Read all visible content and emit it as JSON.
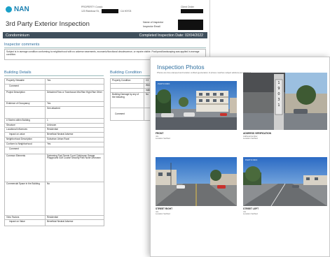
{
  "report": {
    "logo_text": "NAN",
    "property_label": "PROPERTY  Condo",
    "address": "123 Rainbow St,",
    "state_zip": "CA 90703",
    "corner_label": "Client Order",
    "title": "3rd Party Exterior Inspection",
    "name_of_inspector_label": "Name of Inspector",
    "inspector_email_label": "Inspector Email",
    "property_type": "Condominium",
    "completed_label": "Completed Inspection Date: 02/04/2022",
    "inspector_comments_title": "Inspector comments",
    "inspector_comment": "Subject is in average condition conforming to neighborhood with no adverse easements, economic/functional obsolescence, or repairs visible. Pool/pond/landscaping was applied in average condition.",
    "building_details_title": "Building Details",
    "building_condition_title": "Building Condition"
  },
  "building_details": [
    {
      "label": "Property Viewable",
      "value": "Yes"
    },
    {
      "label": "Comment",
      "value": ""
    },
    {
      "label": "Project Description",
      "value": "Detached  Row or Townhouse  Mid-Rise  High-Rise  Other"
    },
    {
      "label": "Evidence of Occupancy",
      "value": "Yes"
    },
    {
      "label": "",
      "value": "See attached"
    },
    {
      "label": "# Stories within Building",
      "value": "1"
    },
    {
      "label": "Structure",
      "value": "Unknown"
    },
    {
      "label": "Locational Influences",
      "value": "Residential"
    },
    {
      "label": "Impact on value",
      "value": "Beneficial  Neutral  Adverse"
    },
    {
      "label": "Neighborhood Description",
      "value": "Suburban  Urban  Rural"
    },
    {
      "label": "Conform to Neighborhood",
      "value": "Yes"
    },
    {
      "label": "Comment",
      "value": ""
    },
    {
      "label": "Common Elements",
      "value": "Swimming Pool  Tennis Court  Clubhouse  Garage  Playground  Golf Course  Security  Park  None  Unknown"
    },
    {
      "label": "Commercial Space in the Building",
      "value": "No"
    },
    {
      "label": "View Factors",
      "value": "Residential"
    },
    {
      "label": "Impact on Value",
      "value": "Beneficial  Neutral  Adverse"
    }
  ],
  "building_condition": [
    {
      "label": "Property Condition",
      "value": "C3"
    },
    {
      "label": "",
      "value": "Wel..."
    },
    {
      "label": "",
      "value": "main..."
    },
    {
      "label": "Building Damage by any of the following",
      "value": "No"
    },
    {
      "label": "Comment",
      "value": ""
    }
  ],
  "photos_page": {
    "title": "Inspection Photos",
    "subtitle": "Photos are time-stamped and location verified (geolocation of photos matches subject address) as indicated.",
    "photos": [
      {
        "tag": "PHOTO INFO",
        "caption": "FRONT",
        "line1": "n/a",
        "line2": "Location Verified",
        "scene": "front"
      },
      {
        "tag": "",
        "caption": "ADDRESS VERIFICATION",
        "line1": "Address/number",
        "line2": "Location Verified",
        "scene": "address"
      },
      {
        "tag": "",
        "caption": "STREET RIGHT",
        "line1": "n/a",
        "line2": "Location Verified",
        "scene": "right"
      },
      {
        "tag": "PHOTO INFO",
        "caption": "STREET LEFT",
        "line1": "n/a",
        "line2": "Location Verified",
        "scene": "left"
      }
    ]
  },
  "colors": {
    "accent": "#2f6f9f",
    "bar": "#3f4f5c",
    "logo": "#1aa0c8"
  }
}
